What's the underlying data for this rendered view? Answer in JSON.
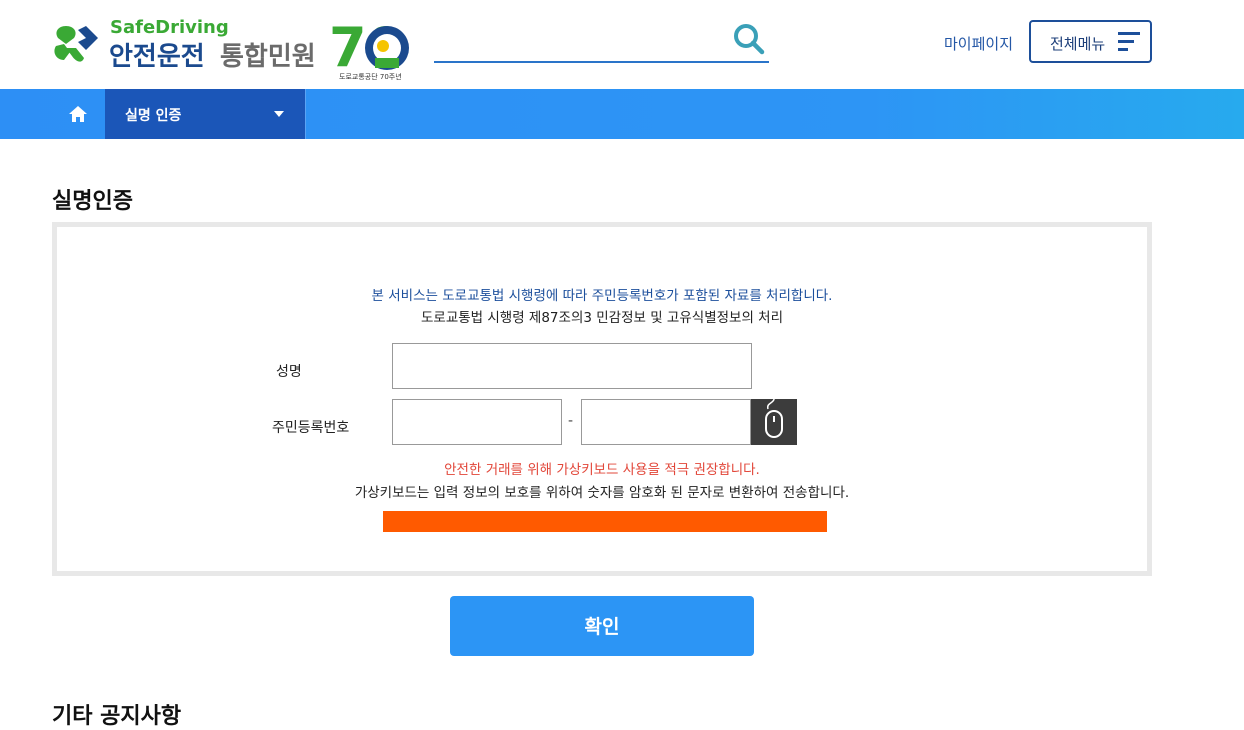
{
  "header": {
    "logo": {
      "brand_en": "SafeDriving",
      "brand_ko": "안전운전",
      "service": "통합민원",
      "anniversary": "70",
      "anniversary_caption": "도로교통공단 70주년"
    },
    "search": {
      "placeholder": "",
      "value": ""
    },
    "mypage_label": "마이페이지",
    "allmenu_label": "전체메뉴"
  },
  "nav": {
    "breadcrumb_label": "실명 인증"
  },
  "main": {
    "title": "실명인증",
    "notice_line1": "본 서비스는 도로교통법 시행령에 따라 주민등록번호가 포함된 자료를 처리합니다.",
    "notice_line2": "도로교통법 시행령 제87조의3 민감정보 및 고유식별정보의 처리",
    "form": {
      "name_label": "성명",
      "name_value": "",
      "rrn_label": "주민등록번호",
      "rrn_front_value": "",
      "rrn_separator": "-",
      "rrn_back_value": ""
    },
    "warning_line1": "안전한 거래를 위해 가상키보드 사용을 적극 권장합니다.",
    "warning_line2": "가상키보드는 입력 정보의 보호를 위하여 숫자를 암호화 된 문자로 변환하여 전송합니다.",
    "confirm_label": "확인",
    "etc_title": "기타 공지사항"
  },
  "colors": {
    "brand_blue": "#1b4a8e",
    "brand_green": "#3aa935",
    "nav_blue": "#2d8ff5",
    "nav_active": "#1b56b8",
    "warning_red": "#e2473a",
    "progress_orange": "#ff5a00",
    "confirm_blue": "#2c95f5"
  },
  "icons": {
    "search": "search-icon",
    "menu": "hamburger-icon",
    "home": "home-icon",
    "virtual_keyboard": "mouse-icon"
  }
}
